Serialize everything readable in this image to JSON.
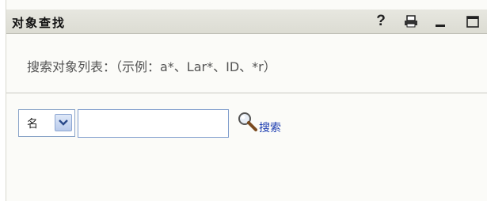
{
  "window": {
    "title": "对象查找",
    "buttons": {
      "help_label": "?"
    }
  },
  "search_panel": {
    "instructions": "搜索对象列表：（示例：a*、Lar*、ID、*r）",
    "attribute_select": {
      "selected": "名"
    },
    "query_input": {
      "value": "",
      "placeholder": ""
    },
    "search_link_label": "搜索"
  },
  "icons": {
    "help": "question-mark-icon",
    "print": "printer-icon",
    "minimize": "minimize-icon",
    "maximize": "maximize-icon",
    "dropdown": "chevron-down-icon",
    "search": "magnifying-glass-icon"
  },
  "colors": {
    "title_bar": "#dcdcd3",
    "link": "#1a3bb0",
    "input_border": "#7f9dcd",
    "dropdown_button": "#b9cbec"
  }
}
